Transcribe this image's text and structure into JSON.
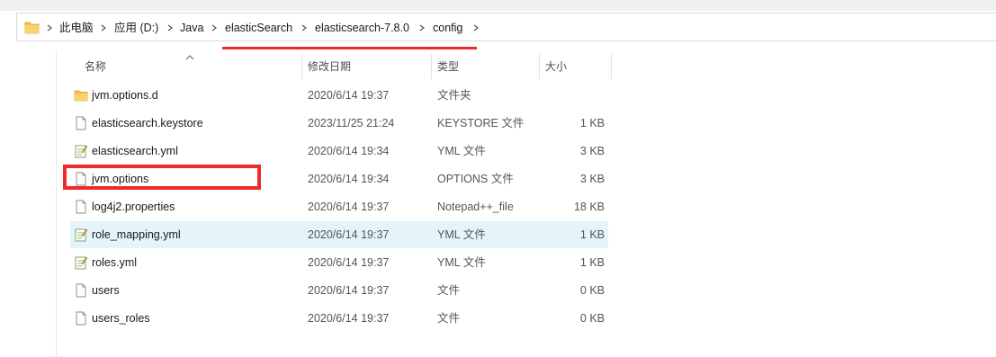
{
  "breadcrumb": {
    "items": [
      "此电脑",
      "应用 (D:)",
      "Java",
      "elasticSearch",
      "elasticsearch-7.8.0",
      "config"
    ]
  },
  "columns": {
    "name": "名称",
    "date": "修改日期",
    "type": "类型",
    "size": "大小"
  },
  "files": [
    {
      "name": "jvm.options.d",
      "date": "2020/6/14 19:37",
      "type": "文件夹",
      "size": "",
      "icon": "folder-icon"
    },
    {
      "name": "elasticsearch.keystore",
      "date": "2023/11/25 21:24",
      "type": "KEYSTORE 文件",
      "size": "1 KB",
      "icon": "file-icon"
    },
    {
      "name": "elasticsearch.yml",
      "date": "2020/6/14 19:34",
      "type": "YML 文件",
      "size": "3 KB",
      "icon": "yml-file-icon"
    },
    {
      "name": "jvm.options",
      "date": "2020/6/14 19:34",
      "type": "OPTIONS 文件",
      "size": "3 KB",
      "icon": "file-icon"
    },
    {
      "name": "log4j2.properties",
      "date": "2020/6/14 19:37",
      "type": "Notepad++_file",
      "size": "18 KB",
      "icon": "file-icon"
    },
    {
      "name": "role_mapping.yml",
      "date": "2020/6/14 19:37",
      "type": "YML 文件",
      "size": "1 KB",
      "icon": "yml-file-icon"
    },
    {
      "name": "roles.yml",
      "date": "2020/6/14 19:37",
      "type": "YML 文件",
      "size": "1 KB",
      "icon": "yml-file-icon"
    },
    {
      "name": "users",
      "date": "2020/6/14 19:37",
      "type": "文件",
      "size": "0 KB",
      "icon": "file-icon"
    },
    {
      "name": "users_roles",
      "date": "2020/6/14 19:37",
      "type": "文件",
      "size": "0 KB",
      "icon": "file-icon"
    }
  ],
  "colors": {
    "annotation_red": "#ee2b2b",
    "selection": "#e5f3fb",
    "folder_yellow": "#f5c342"
  }
}
